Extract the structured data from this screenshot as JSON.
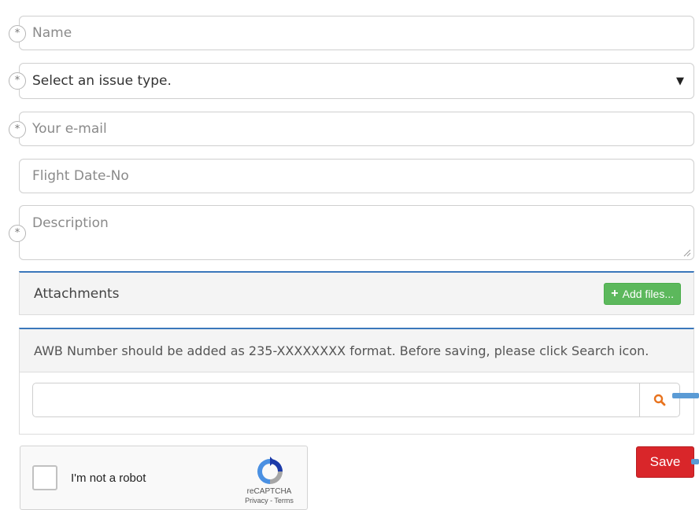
{
  "form": {
    "name_placeholder": "Name",
    "issue_select_value": "Select an issue type.",
    "email_placeholder": "Your e-mail",
    "flight_placeholder": "Flight Date-No",
    "description_placeholder": "Description",
    "required_marker": "*",
    "caret": "▼"
  },
  "attachments": {
    "title": "Attachments",
    "add_files_label": "Add files...",
    "add_icon": "+"
  },
  "awb": {
    "note": "AWB Number should be added as 235-XXXXXXXX format. Before saving, please click Search icon.",
    "input_value": ""
  },
  "captcha": {
    "label": "I'm not a robot",
    "brand": "reCAPTCHA",
    "links": "Privacy - Terms"
  },
  "actions": {
    "save_label": "Save"
  },
  "colors": {
    "save": "#d9262a",
    "add_files": "#5cb85c",
    "panel_accent": "#3a77bb",
    "search_icon": "#e8731e",
    "arrow": "#5b9bd5"
  }
}
